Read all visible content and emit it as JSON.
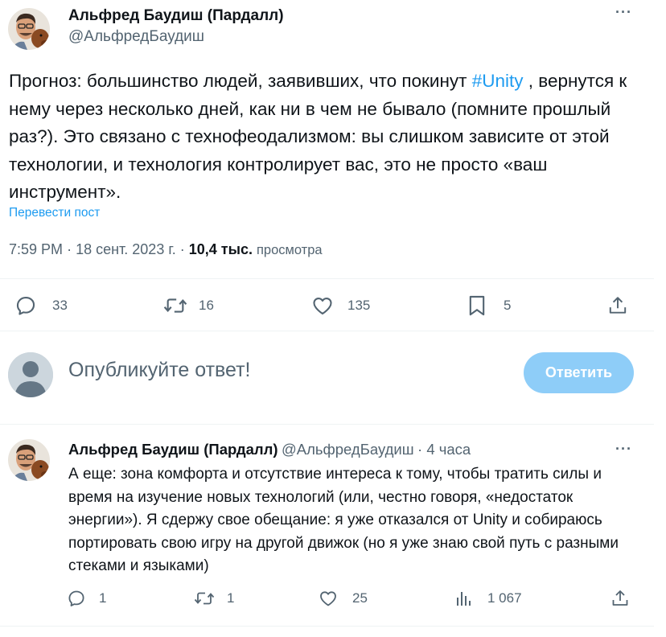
{
  "tweet": {
    "author_name": "Альфред Баудиш (Пардалл)",
    "author_handle": "@АльфредБаудиш",
    "text_before_hashtag": "Прогноз: большинство людей, заявивших, что покинут ",
    "hashtag": "#Unity",
    "text_after_hashtag": " , вернутся к нему через несколько дней, как ни в чем не бывало (помните прошлый раз?). Это связано с технофеодализмом: вы слишком зависите от этой технологии, и технология контролирует вас, это не просто «ваш инструмент».",
    "translate_label": "Перевести пост",
    "time": "7:59 PM",
    "date": "18 сент. 2023 г.",
    "views_count": "10,4 тыс.",
    "views_label": "просмотра",
    "replies": "33",
    "retweets": "16",
    "likes": "135",
    "bookmarks": "5",
    "more_icon": "more-dots-icon"
  },
  "compose": {
    "placeholder": "Опубликуйте ответ!",
    "button_label": "Ответить",
    "button_color": "#8ecdf8"
  },
  "reply": {
    "author_name": "Альфред Баудиш (Пардалл)",
    "author_handle": "@АльфредБаудиш",
    "time_ago": "4 часа",
    "text": "А еще: зона комфорта и отсутствие интереса к тому, чтобы тратить силы и время на изучение новых технологий (или, честно говоря, «недостаток энергии»). Я сдержу свое обещание: я уже отказался от Unity и собираюсь портировать свою игру на другой движок (но я уже знаю свой путь с разными стеками и языками)",
    "replies": "1",
    "retweets": "1",
    "likes": "25",
    "views": "1 067"
  },
  "colors": {
    "accent": "#1d9bf0",
    "secondary_text": "#536471",
    "primary_text": "#0f1419"
  }
}
